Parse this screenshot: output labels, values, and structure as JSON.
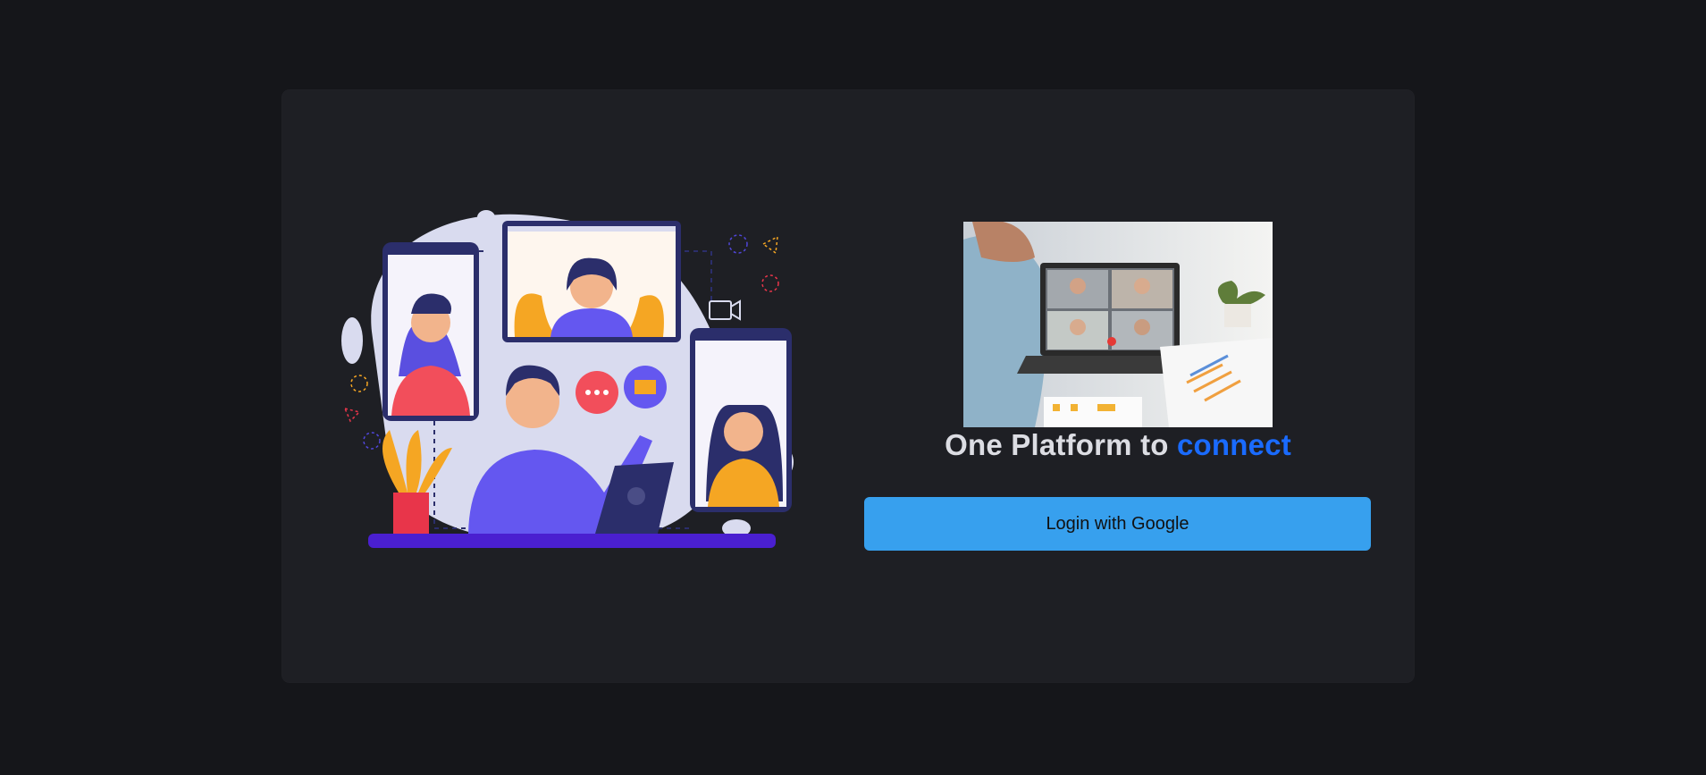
{
  "hero": {
    "headline_prefix": "One Platform to ",
    "headline_accent": "connect"
  },
  "login": {
    "button_label": "Login with Google"
  },
  "colors": {
    "page_background": "#15161a",
    "card_background": "#1e1f24",
    "accent": "#1a6bff",
    "button": "#37a0ee"
  }
}
